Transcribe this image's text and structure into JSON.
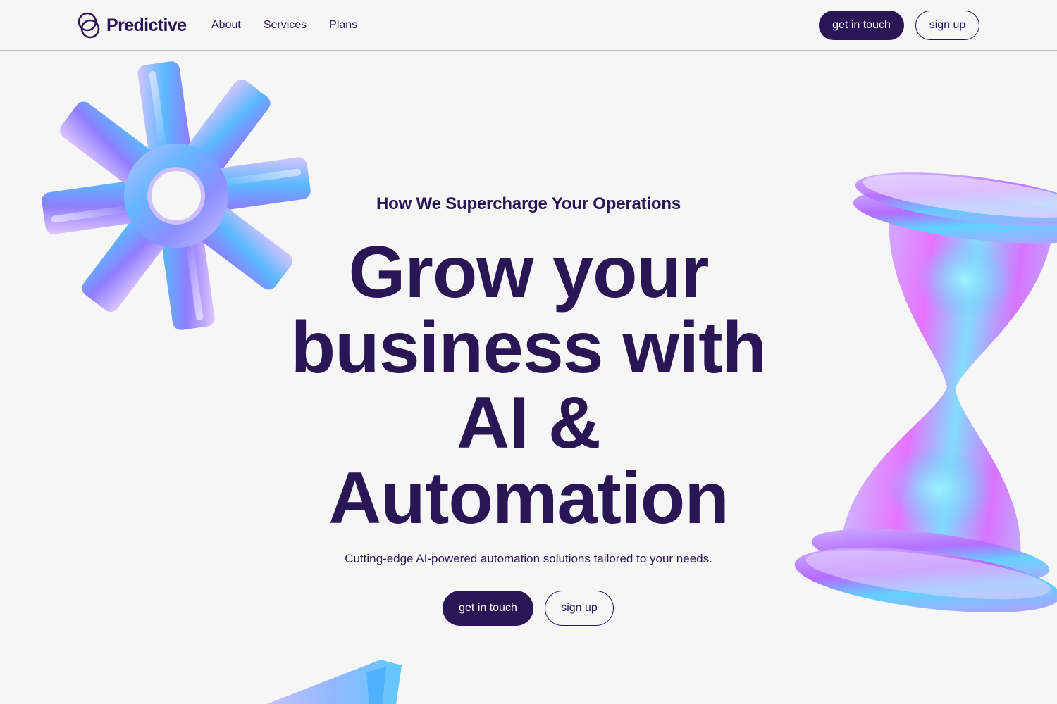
{
  "brand": {
    "name": "Predictive",
    "logo_icon": "overlapping-circles-logo",
    "color": "#2a1654"
  },
  "nav": {
    "items": [
      {
        "label": "About"
      },
      {
        "label": "Services"
      },
      {
        "label": "Plans"
      }
    ]
  },
  "header_actions": {
    "primary_label": "get in touch",
    "secondary_label": "sign up"
  },
  "hero": {
    "eyebrow": "How We Supercharge Your Operations",
    "title_lines": [
      "Grow your",
      "business with",
      "AI &",
      "Automation"
    ],
    "subtitle": "Cutting-edge AI-powered automation solutions tailored to your needs.",
    "primary_label": "get in touch",
    "secondary_label": "sign up"
  },
  "decorations": {
    "gear": "gear-shape-icon",
    "hourglass": "hourglass-icon",
    "triangle": "triangle-shape-icon"
  },
  "colors": {
    "background": "#f6f6f6",
    "primary": "#2a1654",
    "divider": "#bdbbc4",
    "glass_blue": "#3aa7ff",
    "glass_purple": "#c77dff",
    "glass_pink": "#e14fff"
  }
}
